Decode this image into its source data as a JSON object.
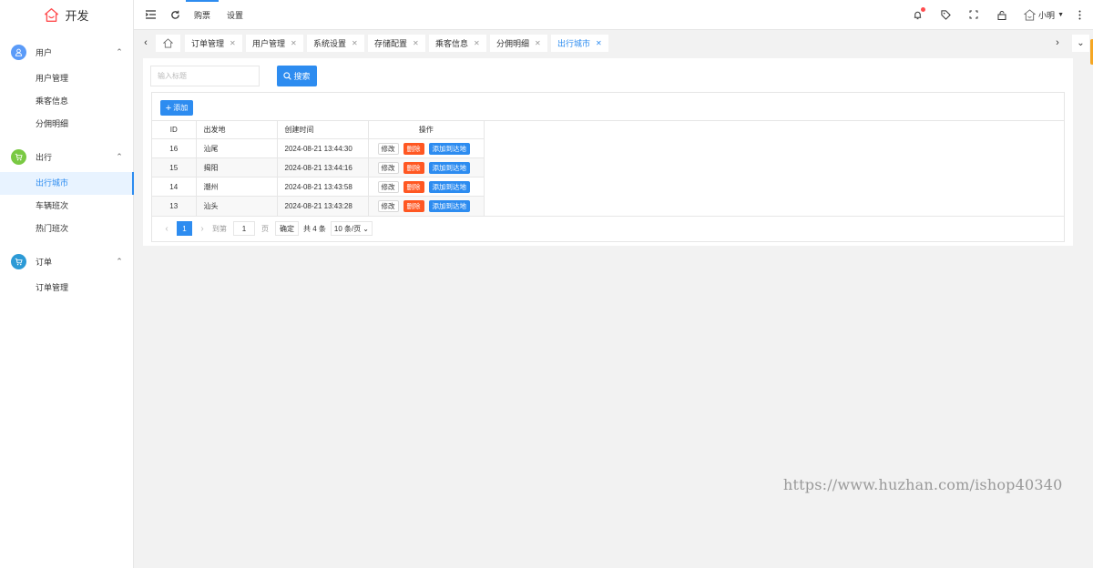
{
  "app": {
    "title": "开发",
    "brand_color": "#ff4d4f"
  },
  "topbar": {
    "nav": [
      {
        "label": "购票",
        "active": true
      },
      {
        "label": "设置",
        "active": false
      }
    ],
    "icons": [
      "menu-fold-icon",
      "refresh-icon",
      "bell-icon",
      "tag-icon",
      "fullscreen-icon",
      "lock-icon"
    ],
    "user": {
      "name": "小明"
    }
  },
  "sidebar": {
    "groups": [
      {
        "label": "用户",
        "icon": "user-icon",
        "color": "#5b9bf8",
        "items": [
          {
            "label": "用户管理",
            "active": false
          },
          {
            "label": "乘客信息",
            "active": false
          },
          {
            "label": "分佣明细",
            "active": false
          }
        ]
      },
      {
        "label": "出行",
        "icon": "cart-icon",
        "color": "#7ac943",
        "items": [
          {
            "label": "出行城市",
            "active": true
          },
          {
            "label": "车辆班次",
            "active": false
          },
          {
            "label": "热门班次",
            "active": false
          }
        ]
      },
      {
        "label": "订单",
        "icon": "cart-icon",
        "color": "#2c9ad6",
        "items": [
          {
            "label": "订单管理",
            "active": false
          }
        ]
      }
    ]
  },
  "tabs": [
    {
      "label": "订单管理"
    },
    {
      "label": "用户管理"
    },
    {
      "label": "系统设置"
    },
    {
      "label": "存储配置"
    },
    {
      "label": "乘客信息"
    },
    {
      "label": "分佣明细"
    },
    {
      "label": "出行城市",
      "active": true
    }
  ],
  "search": {
    "placeholder": "输入标题",
    "button": "搜索"
  },
  "toolbar": {
    "add_label": "添加"
  },
  "table": {
    "headers": [
      "ID",
      "出发地",
      "创建时间",
      "操作"
    ],
    "rows": [
      {
        "id": "16",
        "origin": "汕尾",
        "created": "2024-08-21 13:44:30"
      },
      {
        "id": "15",
        "origin": "揭阳",
        "created": "2024-08-21 13:44:16"
      },
      {
        "id": "14",
        "origin": "潮州",
        "created": "2024-08-21 13:43:58"
      },
      {
        "id": "13",
        "origin": "汕头",
        "created": "2024-08-21 13:43:28"
      }
    ],
    "actions": {
      "edit": "修改",
      "delete": "删除",
      "add_dest": "添加到达地"
    }
  },
  "pagination": {
    "current": "1",
    "goto_label": "到第",
    "goto_value": "1",
    "page_unit": "页",
    "confirm": "确定",
    "total": "共 4 条",
    "page_size": "10 条/页"
  },
  "watermark": "https://www.huzhan.com/ishop40340"
}
